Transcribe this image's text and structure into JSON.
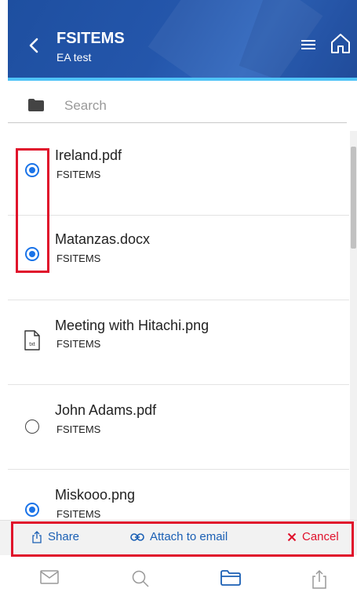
{
  "header": {
    "title": "FSITEMS",
    "subtitle": "EA test",
    "icons": {
      "back": "chevron-left-icon",
      "menu": "menu-icon",
      "home": "home-icon"
    }
  },
  "search": {
    "placeholder": "Search",
    "value": "",
    "icon": "folder-icon"
  },
  "files": [
    {
      "name": "Ireland.pdf",
      "source": "FSITEMS",
      "state": "selected"
    },
    {
      "name": "Matanzas.docx",
      "source": "FSITEMS",
      "state": "selected"
    },
    {
      "name": "Meeting with Hitachi.png",
      "source": "FSITEMS",
      "state": "file-icon",
      "icon_text": "txt"
    },
    {
      "name": "John Adams.pdf",
      "source": "FSITEMS",
      "state": "unselected"
    },
    {
      "name": "Miskooo.png",
      "source": "FSITEMS",
      "state": "selected"
    }
  ],
  "actions": {
    "share": "Share",
    "attach": "Attach to email",
    "cancel": "Cancel"
  },
  "bottom_nav": [
    "mail-icon",
    "search-icon",
    "folder-icon",
    "share-icon"
  ],
  "colors": {
    "header": "#2456ab",
    "accent_line": "#4fc3f7",
    "link_blue": "#1a5fb4",
    "radio_blue": "#1a73e8",
    "cancel_red": "#e0112b",
    "highlight_red": "#e0112b"
  }
}
